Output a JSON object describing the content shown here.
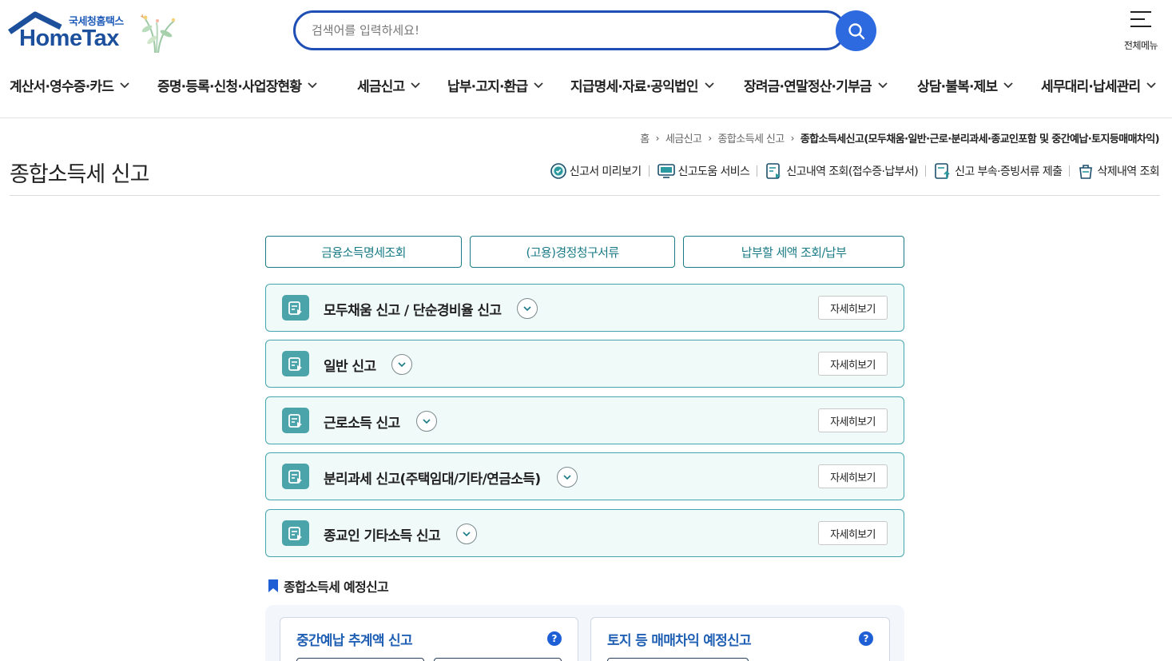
{
  "brand": {
    "sub": "국세청홈택스",
    "main": "HomeTax"
  },
  "search": {
    "placeholder": "검색어를 입력하세요!"
  },
  "menu_all_label": "전체메뉴",
  "gnb": [
    "계산서·영수증·카드",
    "증명·등록·신청·사업장현황",
    "세금신고",
    "납부·고지·환급",
    "지급명세·자료·공익법인",
    "장려금·연말정산·기부금",
    "상담·불복·제보",
    "세무대리·납세관리"
  ],
  "breadcrumb": {
    "home": "홈",
    "items": [
      "세금신고",
      "종합소득세 신고"
    ],
    "current": "종합소득세신고(모두채움·일반·근로·분리과세·종교인포함 및 중간예납·토지등매매차익)"
  },
  "page_title": "종합소득세 신고",
  "quick_links": [
    {
      "label": "신고서 미리보기",
      "icon": "check-circle-icon"
    },
    {
      "label": "신고도움 서비스",
      "icon": "monitor-help-icon"
    },
    {
      "label": "신고내역 조회(접수증·납부서)",
      "icon": "document-search-icon"
    },
    {
      "label": "신고 부속·증빙서류 제출",
      "icon": "document-upload-icon"
    },
    {
      "label": "삭제내역 조회",
      "icon": "trash-icon"
    }
  ],
  "top_buttons": [
    "금융소득명세조회",
    "(고용)경정청구서류",
    "납부할 세액 조회/납부"
  ],
  "accordion": [
    {
      "title": "모두채움 신고 / 단순경비율 신고",
      "more": "자세히보기"
    },
    {
      "title": "일반 신고",
      "more": "자세히보기"
    },
    {
      "title": "근로소득 신고",
      "more": "자세히보기"
    },
    {
      "title": "분리과세 신고(주택임대/기타/연금소득)",
      "more": "자세히보기"
    },
    {
      "title": "종교인 기타소득 신고",
      "more": "자세히보기"
    }
  ],
  "section": {
    "title": "종합소득세 예정신고",
    "cards": [
      {
        "title": "중간예납 추계액 신고",
        "help": "?"
      },
      {
        "title": "토지 등 매매차익 예정신고",
        "help": "?"
      }
    ]
  },
  "colors": {
    "brand_blue": "#1f4fb5",
    "teal": "#1a7b86",
    "teal_icon": "#4aa4a9",
    "accordion_bg": "#f0faf9"
  }
}
